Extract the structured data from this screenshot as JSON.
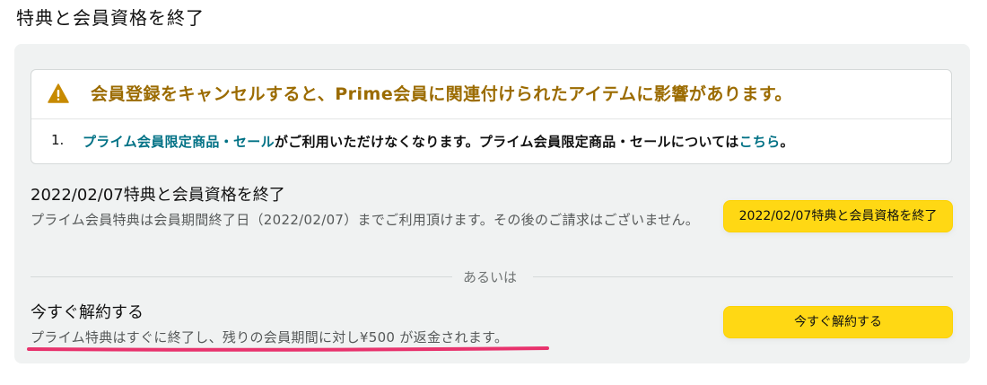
{
  "page": {
    "title": "特典と会員資格を終了"
  },
  "alert": {
    "icon": "warning-icon",
    "title": "会員登録をキャンセルすると、Prime会員に関連付けられたアイテムに影響があります。",
    "items": [
      {
        "number": "1.",
        "link_text": "プライム会員限定商品・セール",
        "text": "がご利用いただけなくなります。プライム会員限定商品・セールについては",
        "link2_text": "こちら",
        "end": "。"
      }
    ]
  },
  "option_end_date": {
    "title": "2022/02/07特典と会員資格を終了",
    "description": "プライム会員特典は会員期間終了日（2022/02/07）までご利用頂けます。その後のご請求はございません。",
    "button_label": "2022/02/07特典と会員資格を終了"
  },
  "divider": {
    "label": "あるいは"
  },
  "option_now": {
    "title": "今すぐ解約する",
    "description": "プライム特典はすぐに終了し、残りの会員期間に対し¥500 が返金されます。",
    "button_label": "今すぐ解約する"
  },
  "colors": {
    "button": "#ffd814",
    "alert_title": "#9b6b00",
    "link": "#007185",
    "highlight_underline": "#e8336d"
  }
}
